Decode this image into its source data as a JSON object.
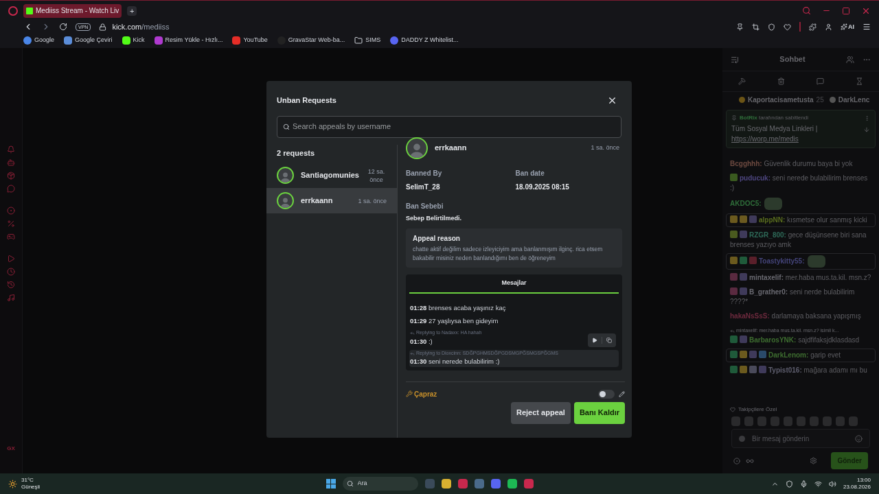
{
  "browser": {
    "tab_title": "Mediiss Stream - Watch Liv",
    "new_tab": "+",
    "url_host": "kick.com",
    "url_path": "/mediiss",
    "vpn": "VPN",
    "ai": "AI",
    "bookmarks": [
      {
        "kind": "google",
        "label": "Google"
      },
      {
        "kind": "translate",
        "label": "Google Çeviri"
      },
      {
        "kind": "kick",
        "label": "Kick"
      },
      {
        "kind": "upload",
        "label": "Resim Yükle - Hızlı..."
      },
      {
        "kind": "youtube",
        "label": "YouTube"
      },
      {
        "kind": "gravastar",
        "label": "GravaStar Web-ba..."
      },
      {
        "kind": "folder",
        "label": "SIMS"
      },
      {
        "kind": "discord",
        "label": "DADDY Z Whitelist..."
      }
    ]
  },
  "sidebar": {
    "footer": "GX"
  },
  "modal": {
    "title": "Unban Requests",
    "search": {
      "placeholder": "Search appeals by username"
    },
    "count": "2 requests",
    "requests": [
      {
        "name": "Santiagomunies",
        "time": "12 sa. önce",
        "selected": false
      },
      {
        "name": "errkaann",
        "time": "1 sa. önce",
        "selected": true
      }
    ],
    "detail": {
      "name": "errkaann",
      "time": "1 sa. önce",
      "banned_by_label": "Banned By",
      "banned_by": "SelimT_28",
      "ban_date_label": "Ban date",
      "ban_date": "18.09.2025 08:15",
      "reason_label": "Ban Sebebi",
      "reason": "Sebep Belirtilmedi.",
      "appeal": {
        "title": "Appeal reason",
        "text": "chatte aktif değilim sadece izleyiciyim ama banlanmışım ilginç. rica etsem bakabilir misiniz neden banlandığımı ben de öğreneyim"
      },
      "messages_tab": {
        "label": "Mesajlar",
        "selected": true
      },
      "messages": [
        {
          "time": "01:28",
          "text": "brenses acaba yaşınız kaç",
          "hovered": false
        },
        {
          "time": "01:29",
          "text": "27 yaşlıysa ben gideyim",
          "hovered": false
        },
        {
          "reply": "Replying to Nadaxx: HA hahah",
          "time": "01:30",
          "text": ":)",
          "hovered": false
        },
        {
          "reply": "Replying to Dioxcinn: SDĞPGHMSDĞPGDSMGPĞSMGSPĞGMS",
          "time": "01:30",
          "text": "seni nerede bulabilirim :)",
          "hovered": true
        }
      ],
      "tag": {
        "label": "Çapraz",
        "on": false
      }
    },
    "actions": {
      "reject": "Reject appeal",
      "unban": "Banı Kaldır"
    }
  },
  "chat": {
    "title": "Sohbet",
    "leaderboard": [
      {
        "name": "Kaportacisametusta",
        "count": "25",
        "color": "#6b5416"
      },
      {
        "name": "DarkLenc",
        "color": "#555555"
      }
    ],
    "pinned": {
      "by": "BotRix",
      "suffix": "tarafından sabitlendi",
      "text": "Tüm Sosyal Medya Linkleri |",
      "link": "https://worp.me/medis"
    },
    "messages": [
      {
        "kind": "text",
        "user": "Bcgghhh:",
        "color": "#6e4a40",
        "text": "Güvenlik durumu baya bi yok",
        "highlighted": false
      },
      {
        "kind": "text",
        "user": "puducuk:",
        "color": "#4e4680",
        "text": "seni nerede bulabilirim brenses :)",
        "highlighted": false,
        "badges": [
          {
            "color": "#3a5a1f"
          }
        ]
      },
      {
        "kind": "emote",
        "user": "AKDOC5:",
        "color": "#2f6e3a",
        "highlighted": false
      },
      {
        "kind": "text",
        "user": "alppNN:",
        "color": "#5a6e1e",
        "text": "kısmetse olur sanmış kicki",
        "highlighted": true,
        "badges": [
          {
            "color": "#6b5a1e"
          },
          {
            "color": "#6b5a20"
          },
          {
            "color": "#3f3a5a"
          }
        ]
      },
      {
        "kind": "text",
        "user": "RZGR_800:",
        "color": "#2e6a58",
        "text": "gece düşünsene biri sana brenses yazıyo amk",
        "highlighted": false,
        "badges": [
          {
            "color": "#4a5a1f"
          },
          {
            "color": "#3f3a5a"
          }
        ]
      },
      {
        "kind": "emote",
        "user": "Toastykitty55:",
        "color": "#44447a",
        "highlighted": true,
        "badges": [
          {
            "color": "#6b5a1e"
          },
          {
            "color": "#1f5a3a"
          },
          {
            "color": "#5a1f2a"
          }
        ]
      },
      {
        "kind": "text",
        "user": "mintaxelif:",
        "color": "#6a6a72",
        "text": "mer.haba mus.ta.kil. msn.z?",
        "highlighted": false,
        "badges": [
          {
            "color": "#5a2a40"
          },
          {
            "color": "#3f3a5a"
          }
        ]
      },
      {
        "kind": "text",
        "user": "B_grather0:",
        "color": "#6a6a72",
        "text": "seni nerde bulabilirim ????*",
        "highlighted": false,
        "badges": [
          {
            "color": "#5a2a40"
          },
          {
            "color": "#3f3a5a"
          }
        ]
      },
      {
        "kind": "text",
        "user": "hakaNsSsS:",
        "color": "#6e2a3e",
        "text": "darlamaya baksana yapışmış",
        "highlighted": false
      },
      {
        "kind": "text",
        "user": "BarbarosYNK:",
        "reply": "mintaxelif: mer.haba mus.ta.kil. msn.z? isimli k...",
        "color": "#3e6e30",
        "text": "sajdfifaksjdklasdasd",
        "highlighted": false,
        "badges": [
          {
            "color": "#1f5a3a"
          },
          {
            "color": "#3f3a5a"
          }
        ]
      },
      {
        "kind": "text",
        "user": "DarkLenom:",
        "color": "#3e6e30",
        "text": "garip evet",
        "highlighted": true,
        "badges": [
          {
            "color": "#1f5a3a"
          },
          {
            "color": "#6b5a1e"
          },
          {
            "color": "#3f3a5a"
          },
          {
            "color": "#2a4a6a"
          }
        ]
      },
      {
        "kind": "text",
        "user": "Typist016:",
        "color": "#5e5e6e",
        "text": "mağara adamı mı bu",
        "highlighted": false,
        "badges": [
          {
            "color": "#1f5a3a"
          },
          {
            "color": "#6b5a1e"
          },
          {
            "color": "#4a4a5a"
          },
          {
            "color": "#3f3a5a"
          }
        ]
      }
    ],
    "followers_label": "Takipçilere Özel",
    "input": {
      "placeholder": "Bir mesaj gönderin"
    },
    "send": "Gönder"
  },
  "taskbar": {
    "temperature": "31°C",
    "weather": "Güneşli",
    "search": {
      "placeholder": "Ara"
    },
    "time": "13:00",
    "date": "23.08.2026"
  }
}
